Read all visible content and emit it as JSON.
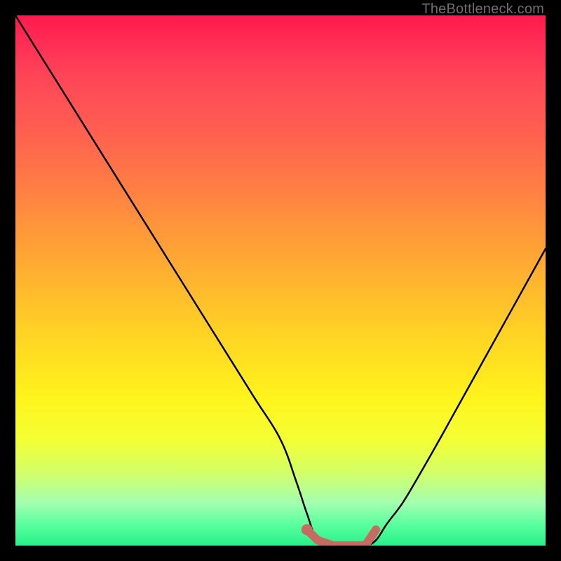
{
  "attribution": "TheBottleneck.com",
  "colors": {
    "frame": "#000000",
    "curve": "#000000",
    "marker": "#c86a64",
    "gradient_top": "#ff1a4d",
    "gradient_bottom": "#28f08a"
  },
  "chart_data": {
    "type": "line",
    "title": "",
    "xlabel": "",
    "ylabel": "",
    "xlim": [
      0,
      100
    ],
    "ylim": [
      0,
      100
    ],
    "description": "Bottleneck curve: high values (bad, red zone) at the extremes, dipping to a minimum (good, green zone) in the mid-range around x ≈ 57–68. Left descent is steeper than right ascent. A short flat segment of the minimum is highlighted.",
    "series": [
      {
        "name": "bottleneck_percent",
        "x": [
          0,
          5,
          10,
          15,
          20,
          25,
          30,
          35,
          40,
          45,
          50,
          53,
          55,
          57,
          60,
          63,
          66,
          68,
          70,
          73,
          76,
          80,
          85,
          90,
          95,
          100
        ],
        "values": [
          100,
          92,
          84,
          76,
          68,
          60,
          52,
          44,
          36,
          28,
          20,
          12,
          6,
          1,
          0,
          0,
          0,
          1,
          4,
          8,
          13,
          20,
          29,
          38,
          47,
          56
        ]
      }
    ],
    "highlight_segment": {
      "name": "optimal_range_marker",
      "x": [
        55,
        57,
        60,
        63,
        66,
        68
      ],
      "values": [
        3,
        1,
        0,
        0,
        0,
        3
      ]
    }
  }
}
